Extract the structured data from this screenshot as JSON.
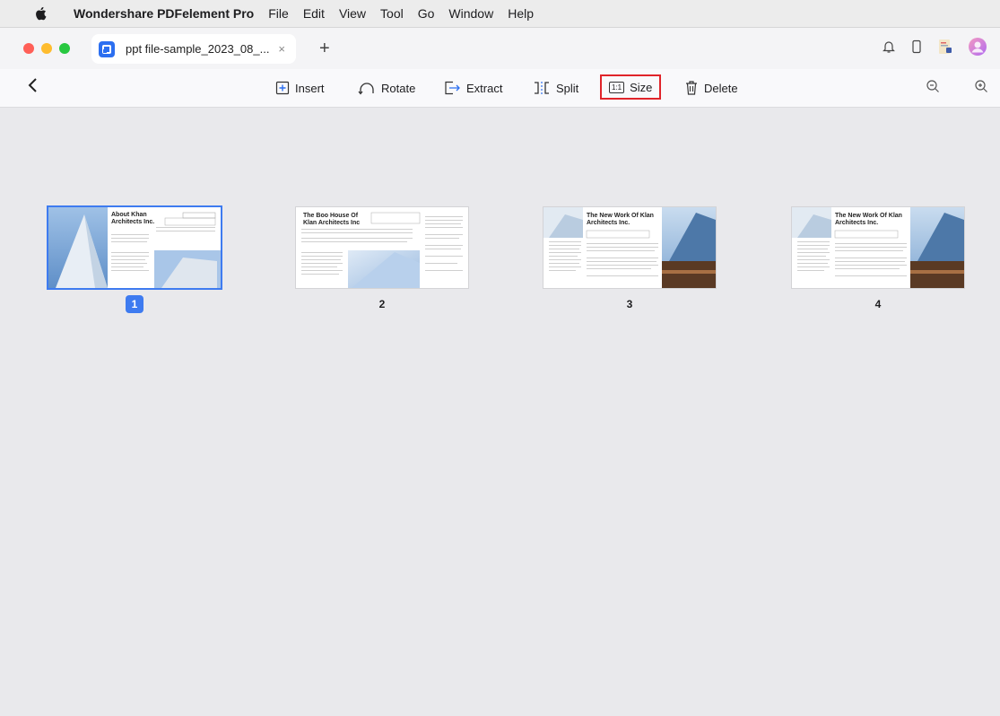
{
  "menubar": {
    "app_name": "Wondershare PDFelement Pro",
    "items": [
      "File",
      "Edit",
      "View",
      "Tool",
      "Go",
      "Window",
      "Help"
    ]
  },
  "tab": {
    "title": "ppt file-sample_2023_08_...",
    "close": "×",
    "new_tab": "+"
  },
  "toolbar": {
    "insert": "Insert",
    "rotate": "Rotate",
    "extract": "Extract",
    "split": "Split",
    "size": "Size",
    "size_icon_text": "1:1",
    "delete": "Delete"
  },
  "pages": [
    {
      "number": "1",
      "title": "About Khan Architects Inc.",
      "selected": true
    },
    {
      "number": "2",
      "title": "The Boo House Of Klan Architects Inc",
      "selected": false
    },
    {
      "number": "3",
      "title": "The New Work Of Klan Architects Inc.",
      "selected": false
    },
    {
      "number": "4",
      "title": "The New Work Of Klan Architects Inc.",
      "selected": false
    }
  ],
  "colors": {
    "accent": "#3e7bf0",
    "highlight_border": "#e0242a",
    "traffic_red": "#ff5f57",
    "traffic_yellow": "#febc2e",
    "traffic_green": "#28c840"
  }
}
